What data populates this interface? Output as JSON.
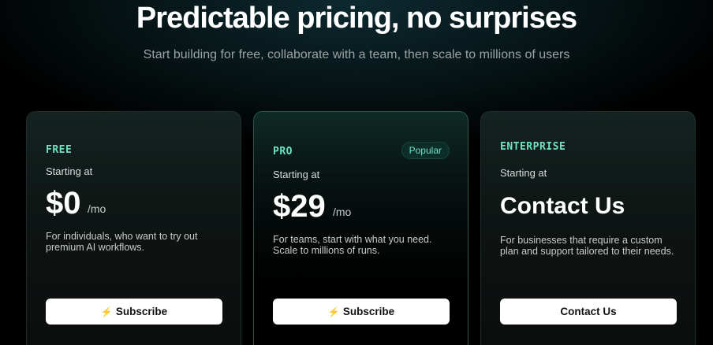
{
  "header": {
    "title": "Predictable pricing, no surprises",
    "subtitle": "Start building for free, collaborate with a team, then scale to millions of users"
  },
  "plans": [
    {
      "name": "FREE",
      "starting": "Starting at",
      "price": "$0",
      "per": "/mo",
      "description": "For individuals, who want to try out premium AI workflows.",
      "button": "Subscribe",
      "button_icon": "bolt-icon"
    },
    {
      "name": "PRO",
      "badge": "Popular",
      "starting": "Starting at",
      "price": "$29",
      "per": "/mo",
      "description": "For teams, start with what you need. Scale to millions of runs.",
      "button": "Subscribe",
      "button_icon": "bolt-icon"
    },
    {
      "name": "ENTERPRISE",
      "starting": "Starting at",
      "price": "Contact Us",
      "description": "For businesses that require a custom plan and support tailored to their needs.",
      "button": "Contact Us"
    }
  ],
  "colors": {
    "accent": "#6ee2c3",
    "bolt": "#f0b400",
    "background": "#000000",
    "button": "#ffffff"
  }
}
